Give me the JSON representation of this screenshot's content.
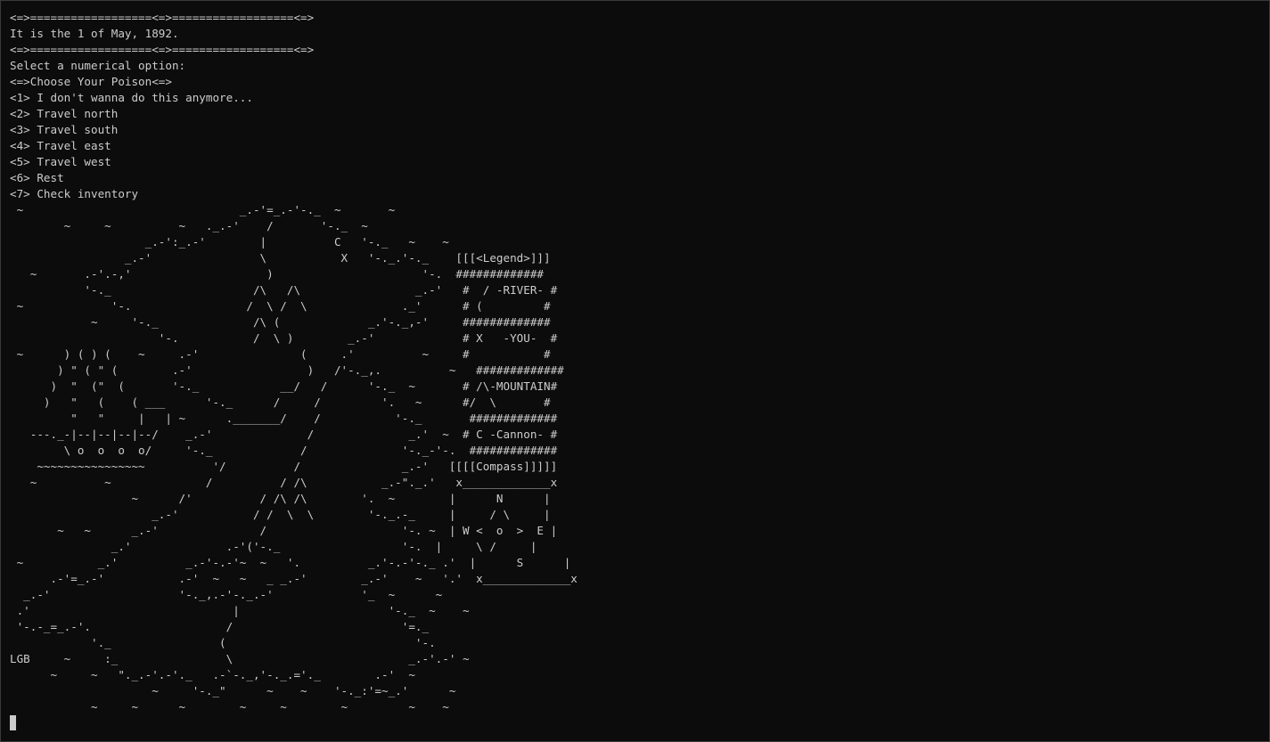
{
  "terminal": {
    "colors": {
      "background": "#0c0c0c",
      "foreground": "#cccccc",
      "border": "#3a3a3a"
    },
    "lines": [
      "<=>==================<=>==================<=>",
      "It is the 1 of May, 1892.",
      "<=>==================<=>==================<=>",
      "Select a numerical option:",
      "<=>Choose Your Poison<=>",
      "<1> I don't wanna do this anymore...",
      "<2> Travel north",
      "<3> Travel south",
      "<4> Travel east",
      "<5> Travel west",
      "<6> Rest",
      "<7> Check inventory",
      " ~                                _.-'=_.-'-._  ~       ~",
      "        ~     ~          ~   ._.-'    /       '-._  ~",
      "                    _.-':_.-'        |          C   '-._   ~    ~",
      "                 _.-'                \\           X   '-._.'-._    [[[<Legend>]]]",
      "   ~       .-'.-,'                    )                      '-.  #############",
      "           '-._                     /\\   /\\                 _.-'   #  / -RIVER- #",
      " ~             '-.                 /  \\ /  \\              ._'      # (         #",
      "            ~     '-._              /\\ (             _.'-._,-'     #############",
      "                      '-.           /  \\ )        _.-'             # X   -YOU-  #",
      " ~      ) ( ) (    ~     .-'               (     .'          ~     #           #",
      "       ) \" ( \" (        .-'                 )   /'-._,.          ~   #############",
      "      )  \"  (\"  (       '-._            __/   /      '-._  ~       # /\\-MOUNTAIN#",
      "     )   \"   (    ( ___      '-._      /     /         '.   ~      #/  \\       #",
      "         \"   \"     |   | ~      ._______/    /           '-._       #############",
      "   ---._-|--|--|--|--/    _.-'              /              _.'  ~  # C -Cannon- #",
      "        \\ o  o  o  o/     '-._             /              '-._-'-.  #############",
      "    ~~~~~~~~~~~~~~~~          '/          /               _.-'   [[[[Compass]]]]]",
      "   ~          ~              /          / /\\           _.-\"._.'   x_____________x",
      "                  ~      /'          / /\\ /\\        '.  ~        |      N      |",
      "                     _.-'           / /  \\  \\        '-._.-_     |     / \\     |",
      "       ~   ~      _.-'               /                    '-. ~  | W <  o  >  E |",
      "               _.'              .-'('-._                  '-.  |     \\ /     |",
      " ~           _.'          _.-'-.-'~  ~   '.          _.'-.-'-._ .'  |      S      |",
      "      .-'=_.-'           .-'  ~   ~   _ _.-'        _.-'    ~   '.'  x_____________x",
      "  _.-'                   '-._,.-'-._.-'             '_  ~      ~",
      " .'                              |                      '-._  ~    ~",
      " '-.-_=_.-'.                    /                         '=._",
      "            '._                (                            '-.",
      "LGB     ~     :_                \\                          _.-'.-' ~",
      "      ~     ~   \"._.-'.-'._   .-`-._,'-._.='._        .-'  ~",
      "                     ~     '-._\"      ~    ~    '-._:'=~_.'      ~",
      "            ~     ~      ~        ~     ~        ~         ~    ~"
    ]
  }
}
